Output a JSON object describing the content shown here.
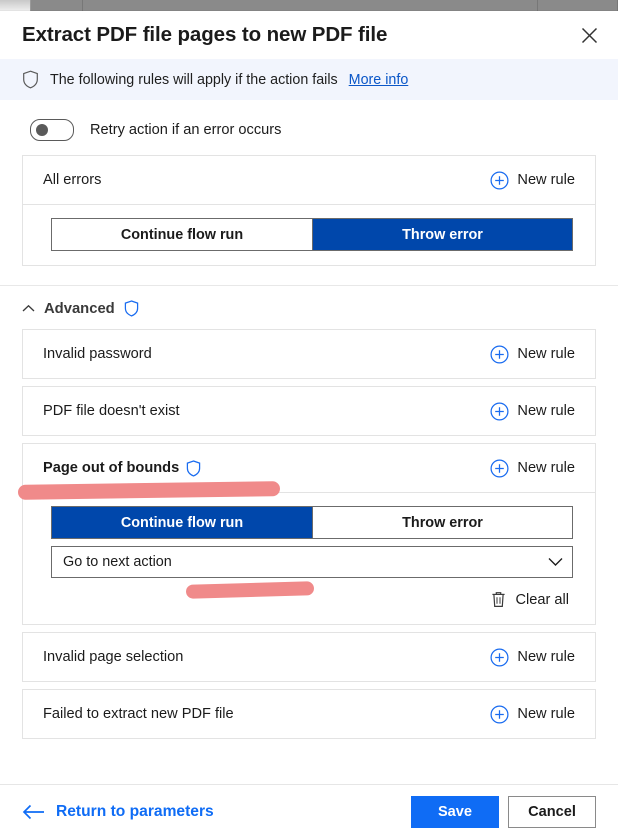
{
  "dialog": {
    "title": "Extract PDF file pages to new PDF file",
    "close_icon": "close-icon"
  },
  "banner": {
    "shield_icon": "shield-icon",
    "text": "The following rules will apply if the action fails",
    "link_label": "More info",
    "background": "#f2f5fd"
  },
  "retry": {
    "label": "Retry action if an error occurs",
    "enabled": false
  },
  "all_errors_card": {
    "title": "All errors",
    "new_rule_label": "New rule",
    "segments": [
      {
        "label": "Continue flow run",
        "selected": false
      },
      {
        "label": "Throw error",
        "selected": true
      }
    ]
  },
  "advanced": {
    "label": "Advanced",
    "chevron_icon": "chevron-up-icon",
    "shield_icon": "shield-icon",
    "expanded": true
  },
  "rules": [
    {
      "title": "Invalid password",
      "new_rule_label": "New rule",
      "bold": false,
      "shield": false,
      "expanded": false
    },
    {
      "title": "PDF file doesn't exist",
      "new_rule_label": "New rule",
      "bold": false,
      "shield": false,
      "expanded": false
    },
    {
      "title": "Page out of bounds",
      "new_rule_label": "New rule",
      "bold": true,
      "shield": true,
      "expanded": true,
      "segments": [
        {
          "label": "Continue flow run",
          "selected": true
        },
        {
          "label": "Throw error",
          "selected": false
        }
      ],
      "dropdown_value": "Go to next action",
      "clear_all_label": "Clear all",
      "trash_icon": "trash-icon"
    },
    {
      "title": "Invalid page selection",
      "new_rule_label": "New rule",
      "bold": false,
      "shield": false,
      "expanded": false
    },
    {
      "title": "Failed to extract new PDF file",
      "new_rule_label": "New rule",
      "bold": false,
      "shield": false,
      "expanded": false
    }
  ],
  "footer": {
    "return_label": "Return to parameters",
    "back_arrow_icon": "arrow-left-icon",
    "save_label": "Save",
    "cancel_label": "Cancel"
  },
  "colors": {
    "segment_selected_blue": "#0047ab",
    "primary_blue": "#0f6cf5",
    "link_blue": "#0b57c8",
    "banner_blue": "#f2f5fd",
    "marker_pink": "#f08a8a",
    "icon_blue": "#1a6cf0"
  },
  "annotations": [
    {
      "name": "highlight-page-out-of-bounds",
      "color": "#f08a8a"
    },
    {
      "name": "highlight-go-to-next-action",
      "color": "#f08a8a"
    }
  ]
}
